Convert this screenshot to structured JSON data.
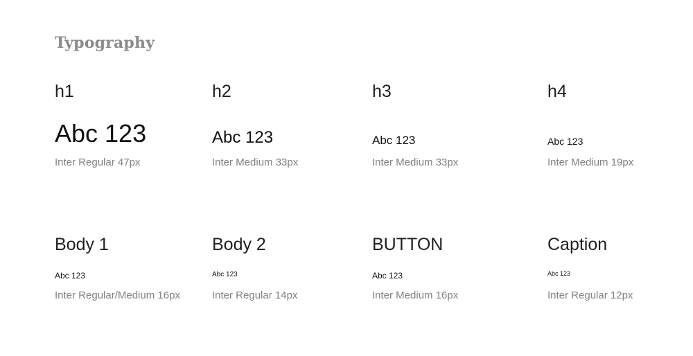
{
  "page": {
    "title": "Typography"
  },
  "styles": [
    {
      "name": "h1",
      "sample": "Abc 123",
      "spec": "Inter Regular 47px"
    },
    {
      "name": "h2",
      "sample": "Abc 123",
      "spec": "Inter Medium 33px"
    },
    {
      "name": "h3",
      "sample": "Abc 123",
      "spec": "Inter Medium 33px"
    },
    {
      "name": "h4",
      "sample": "Abc 123",
      "spec": "Inter Medium 19px"
    },
    {
      "name": "Body 1",
      "sample": "Abc 123",
      "spec": "Inter Regular/Medium 16px"
    },
    {
      "name": "Body 2",
      "sample": "Abc 123",
      "spec": "Inter Regular 14px"
    },
    {
      "name": "BUTTON",
      "sample": "Abc 123",
      "spec": "Inter Medium 16px"
    },
    {
      "name": "Caption",
      "sample": "Abc 123",
      "spec": "Inter Regular 12px"
    }
  ]
}
